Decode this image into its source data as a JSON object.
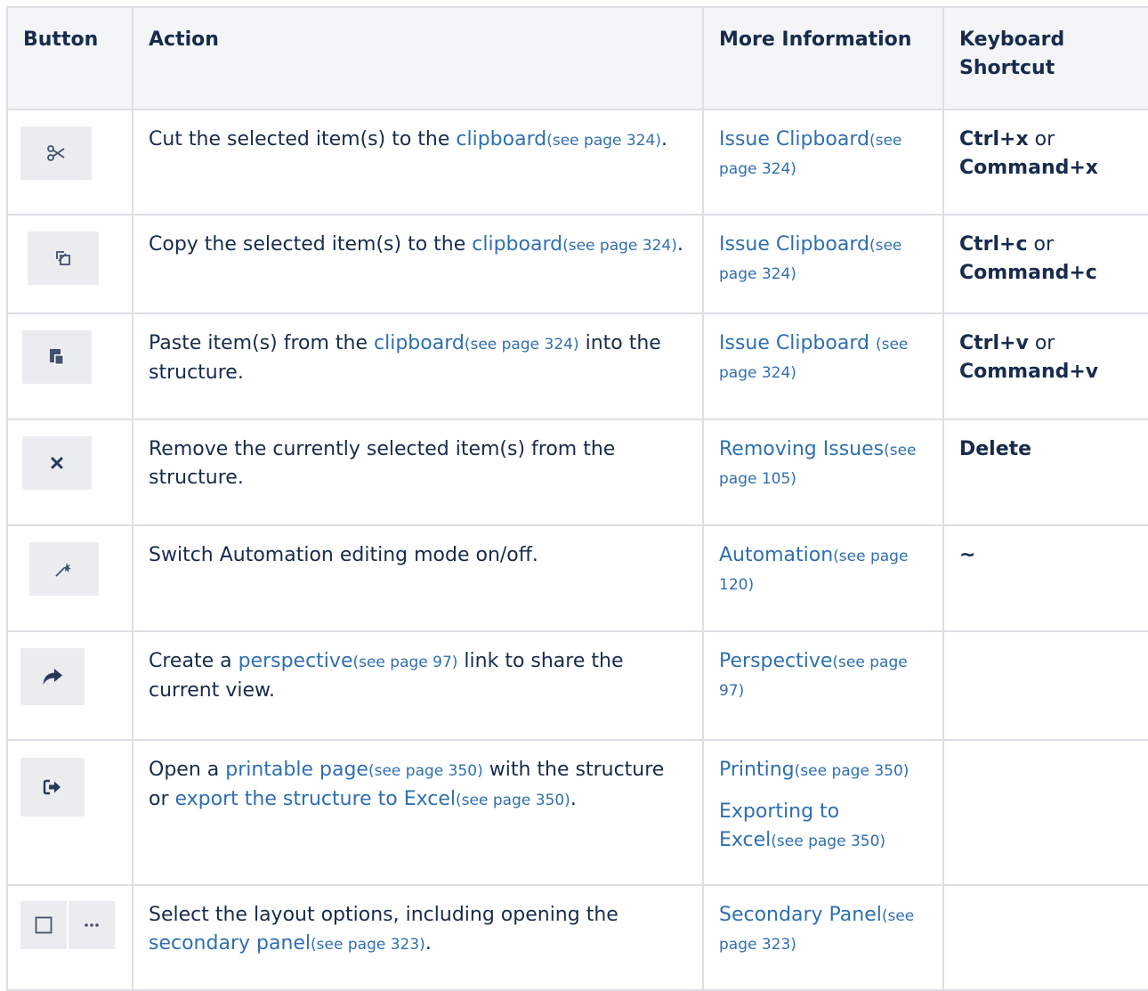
{
  "headers": {
    "button": "Button",
    "action": "Action",
    "more_info": "More Information",
    "shortcut": "Keyboard Shortcut"
  },
  "rows": [
    {
      "icon": "scissors-icon",
      "action_pre": "Cut the selected item(s) to the ",
      "action_link": "clipboard",
      "action_link_ref": "(see page 324)",
      "action_post": ".",
      "info": [
        {
          "text": "Issue Clipboard",
          "ref": "(see page 324)"
        }
      ],
      "shortcut_a": "Ctrl+x",
      "shortcut_or": " or",
      "shortcut_b": "Command+x"
    },
    {
      "icon": "copy-icon",
      "action_pre": "Copy the selected item(s) to the ",
      "action_link": "clipboard",
      "action_link_ref": "(see page 324)",
      "action_post": ".",
      "info": [
        {
          "text": "Issue Clipboard",
          "ref": "(see page 324)"
        }
      ],
      "shortcut_a": "Ctrl+c",
      "shortcut_or": " or",
      "shortcut_b": "Command+c"
    },
    {
      "icon": "paste-icon",
      "action_pre": "Paste item(s) from the ",
      "action_link": "clipboard",
      "action_link_ref": "(see page 324)",
      "action_post": " into the structure.",
      "info": [
        {
          "text": "Issue Clipboard ",
          "ref": "(see page 324)"
        }
      ],
      "shortcut_a": "Ctrl+v",
      "shortcut_or": " or",
      "shortcut_b": "Command+v"
    },
    {
      "icon": "remove-x-icon",
      "action_text": "Remove the currently selected item(s) from the structure.",
      "info": [
        {
          "text": "Removing Issues",
          "ref": "(see page 105)"
        }
      ],
      "shortcut_single": "Delete"
    },
    {
      "icon": "magic-wand-icon",
      "action_text": "Switch Automation editing mode on/off.",
      "info": [
        {
          "text": "Automation",
          "ref": "(see page 120)"
        }
      ],
      "shortcut_single": "~"
    },
    {
      "icon": "share-arrow-icon",
      "action_pre": "Create a ",
      "action_link": "perspective",
      "action_link_ref": "(see page 97)",
      "action_post": " link to share the current view.",
      "info": [
        {
          "text": "Perspective",
          "ref": "(see page 97)"
        }
      ],
      "shortcut_single": ""
    },
    {
      "icon": "export-icon",
      "action_pre": "Open a ",
      "action_link": "printable page",
      "action_link_ref": "(see page 350)",
      "action_mid": " with the structure or ",
      "action_link2": "export the structure to Excel",
      "action_link2_ref": "(see page 350)",
      "action_post": ".",
      "info": [
        {
          "text": "Printing",
          "ref": "(see page 350)"
        },
        {
          "text": "Exporting to Excel",
          "ref": "(see page 350)"
        }
      ],
      "shortcut_single": ""
    },
    {
      "icon": "layout-options-icon",
      "action_pre": "Select the layout options, including opening the ",
      "action_link": "secondary panel",
      "action_link_ref": "(see page 323)",
      "action_post": ".",
      "info": [
        {
          "text": "Secondary Panel",
          "ref": "(see page 323)"
        }
      ],
      "shortcut_single": ""
    }
  ]
}
